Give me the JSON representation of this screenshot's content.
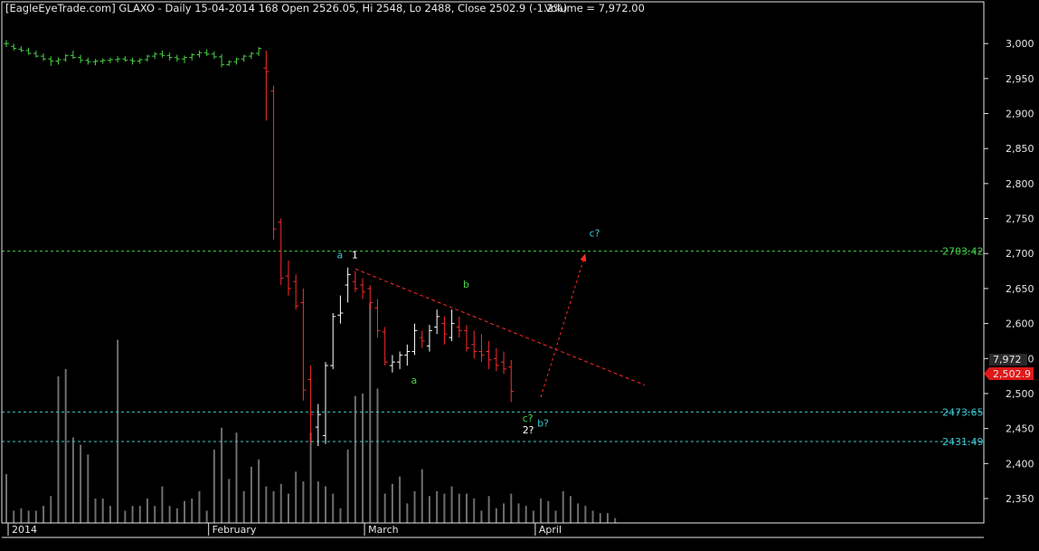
{
  "header": {
    "title": "[EagleEyeTrade.com] GLAXO - Daily 15-04-2014 168 Open 2526.05, Hi 2548, Lo 2488, Close 2502.9 (-1.2%)",
    "volume_text": "Volume = 7,972.00"
  },
  "chart_data": {
    "type": "ohlc",
    "title": "[EagleEyeTrade.com] GLAXO - Daily 15-04-2014 168 Open 2526.05, Hi 2548, Lo 2488, Close 2502.9 (-1.2%)",
    "ylim": [
      2310,
      3010
    ],
    "y_ticks": [
      2350,
      2400,
      2450,
      2500,
      2550,
      2600,
      2650,
      2700,
      2750,
      2800,
      2850,
      2900,
      2950,
      3000
    ],
    "y_tick_labels": [
      "2,350",
      "2,400",
      "2,450",
      "2,500",
      "2,550",
      "2,600",
      "2,650",
      "2,700",
      "2,750",
      "2,800",
      "2,850",
      "2,900",
      "2,950",
      "3,000"
    ],
    "x_labels": [
      "2014",
      "February",
      "March",
      "April"
    ],
    "x_label_bar_index": [
      0,
      27,
      48,
      71
    ],
    "bars": [
      [
        3000,
        3005,
        2995,
        3000
      ],
      [
        2996,
        3000,
        2990,
        2993
      ],
      [
        2992,
        2996,
        2988,
        2990
      ],
      [
        2990,
        2994,
        2984,
        2986
      ],
      [
        2986,
        2990,
        2980,
        2982
      ],
      [
        2982,
        2986,
        2975,
        2978
      ],
      [
        2978,
        2982,
        2968,
        2975
      ],
      [
        2975,
        2980,
        2970,
        2977
      ],
      [
        2977,
        2985,
        2974,
        2983
      ],
      [
        2983,
        2990,
        2978,
        2980
      ],
      [
        2980,
        2984,
        2972,
        2976
      ],
      [
        2976,
        2980,
        2970,
        2974
      ],
      [
        2974,
        2978,
        2969,
        2975
      ],
      [
        2975,
        2979,
        2971,
        2976
      ],
      [
        2976,
        2980,
        2972,
        2977
      ],
      [
        2977,
        2982,
        2973,
        2978
      ],
      [
        2978,
        2982,
        2974,
        2976
      ],
      [
        2976,
        2980,
        2970,
        2975
      ],
      [
        2975,
        2979,
        2971,
        2977
      ],
      [
        2977,
        2984,
        2974,
        2982
      ],
      [
        2982,
        2988,
        2978,
        2985
      ],
      [
        2985,
        2990,
        2980,
        2983
      ],
      [
        2983,
        2987,
        2976,
        2980
      ],
      [
        2980,
        2984,
        2974,
        2978
      ],
      [
        2978,
        2983,
        2972,
        2980
      ],
      [
        2980,
        2986,
        2976,
        2984
      ],
      [
        2984,
        2990,
        2980,
        2987
      ],
      [
        2987,
        2992,
        2982,
        2985
      ],
      [
        2985,
        2989,
        2978,
        2981
      ],
      [
        2981,
        2985,
        2966,
        2970
      ],
      [
        2970,
        2976,
        2968,
        2974
      ],
      [
        2974,
        2980,
        2970,
        2978
      ],
      [
        2978,
        2984,
        2974,
        2982
      ],
      [
        2982,
        2988,
        2978,
        2986
      ],
      [
        2986,
        2995,
        2982,
        2993
      ],
      [
        2965,
        2990,
        2890,
        2960
      ],
      [
        2932,
        2940,
        2720,
        2735
      ],
      [
        2745,
        2750,
        2655,
        2665
      ],
      [
        2668,
        2690,
        2640,
        2650
      ],
      [
        2660,
        2670,
        2620,
        2625
      ],
      [
        2630,
        2650,
        2490,
        2505
      ],
      [
        2520,
        2540,
        2430,
        2470
      ],
      [
        2452,
        2485,
        2425,
        2470
      ],
      [
        2440,
        2545,
        2428,
        2540
      ],
      [
        2540,
        2615,
        2535,
        2610
      ],
      [
        2612,
        2640,
        2600,
        2615
      ],
      [
        2655,
        2680,
        2630,
        2670
      ],
      [
        2660,
        2675,
        2645,
        2650
      ],
      [
        2655,
        2665,
        2635,
        2645
      ],
      [
        2650,
        2655,
        2620,
        2630
      ],
      [
        2622,
        2635,
        2580,
        2590
      ],
      [
        2588,
        2595,
        2540,
        2545
      ],
      [
        2540,
        2555,
        2530,
        2545
      ],
      [
        2545,
        2560,
        2535,
        2555
      ],
      [
        2555,
        2570,
        2540,
        2560
      ],
      [
        2560,
        2600,
        2555,
        2590
      ],
      [
        2580,
        2590,
        2565,
        2575
      ],
      [
        2568,
        2598,
        2560,
        2590
      ],
      [
        2595,
        2620,
        2585,
        2610
      ],
      [
        2600,
        2610,
        2570,
        2585
      ],
      [
        2580,
        2620,
        2575,
        2600
      ],
      [
        2595,
        2610,
        2580,
        2590
      ],
      [
        2590,
        2598,
        2560,
        2565
      ],
      [
        2570,
        2590,
        2550,
        2560
      ],
      [
        2560,
        2585,
        2545,
        2555
      ],
      [
        2560,
        2575,
        2535,
        2548
      ],
      [
        2550,
        2565,
        2532,
        2540
      ],
      [
        2545,
        2560,
        2528,
        2535
      ],
      [
        2538,
        2548,
        2488,
        2503
      ]
    ],
    "volume_relative": [
      0.2,
      0.05,
      0.06,
      0.05,
      0.05,
      0.07,
      0.11,
      0.6,
      0.63,
      0.35,
      0.32,
      0.28,
      0.1,
      0.1,
      0.07,
      0.75,
      0.05,
      0.07,
      0.07,
      0.1,
      0.07,
      0.15,
      0.07,
      0.06,
      0.09,
      0.1,
      0.13,
      0.05,
      0.3,
      0.39,
      0.18,
      0.37,
      0.13,
      0.23,
      0.26,
      0.15,
      0.13,
      0.16,
      0.12,
      0.21,
      0.17,
      0.37,
      0.17,
      0.15,
      0.12,
      0.06,
      0.3,
      0.52,
      0.53,
      0.9,
      0.55,
      0.12,
      0.16,
      0.19,
      0.08,
      0.13,
      0.22,
      0.11,
      0.13,
      0.12,
      0.15,
      0.12,
      0.12,
      0.1,
      0.05,
      0.11,
      0.06,
      0.08,
      0.12,
      0.08,
      0.07,
      0.05,
      0.1,
      0.09,
      0.05,
      0.13,
      0.11,
      0.08,
      0.07,
      0.05,
      0.04,
      0.04,
      0.02
    ],
    "horizontal_lines": [
      {
        "value": 2703.42,
        "label": "2703.42",
        "color": "#46d246"
      },
      {
        "value": 2473.65,
        "label": "2473.65",
        "color": "#3cc8d2"
      },
      {
        "value": 2431.49,
        "label": "2431.49",
        "color": "#3cc8d2"
      }
    ],
    "trendline": {
      "from": {
        "bar": 47,
        "value": 2678
      },
      "to": {
        "bar": 86,
        "value": 2512
      },
      "color": "#ff2a2a"
    },
    "projection_arrow": {
      "from": {
        "bar": 72,
        "value": 2495
      },
      "to": {
        "bar": 78,
        "value": 2700
      },
      "color": "#ff2a2a"
    },
    "wave_labels": [
      {
        "text": "a",
        "bar": 45,
        "value": 2693,
        "color": "#3cc8d2"
      },
      {
        "text": "1",
        "bar": 47,
        "value": 2693,
        "color": "#ffffff"
      },
      {
        "text": "b",
        "bar": 62,
        "value": 2651,
        "color": "#46d246"
      },
      {
        "text": "a",
        "bar": 55,
        "value": 2514,
        "color": "#46d246"
      },
      {
        "text": "c?",
        "bar": 70,
        "value": 2460,
        "color": "#46d246"
      },
      {
        "text": "b?",
        "bar": 72,
        "value": 2453,
        "color": "#3cc8d2"
      },
      {
        "text": "2?",
        "bar": 70,
        "value": 2443,
        "color": "#ffffff"
      },
      {
        "text": "c?",
        "bar": 79,
        "value": 2724,
        "color": "#3cc8d2"
      }
    ],
    "last_volume_label": "7,972",
    "last_close_label": "2,502.9",
    "colors": {
      "up": "#ffffff",
      "down": "#ff2a2a",
      "early": "#46d246",
      "volume": "#6e6e6e",
      "background": "#000000",
      "grid": "#e6e6e6"
    }
  }
}
